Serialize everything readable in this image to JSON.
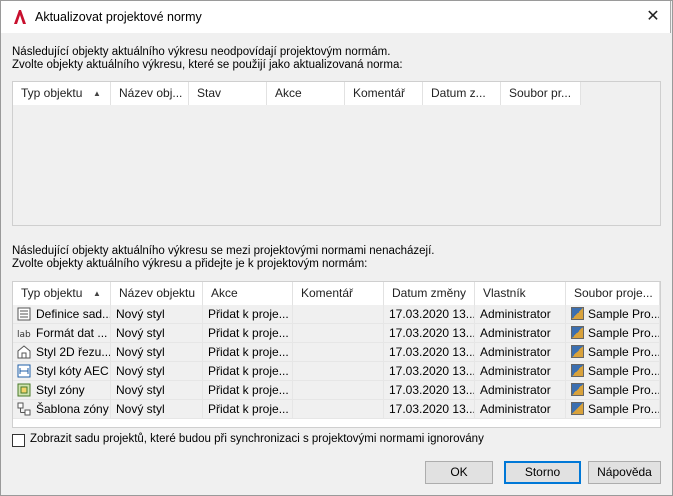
{
  "window": {
    "title": "Aktualizovat projektové normy"
  },
  "section1": {
    "line1": "Následující objekty aktuálního výkresu neodpovídají projektovým normám.",
    "line2": "Zvolte objekty aktuálního výkresu, které se použijí jako aktualizovaná norma:",
    "columns": [
      "Typ objektu",
      "Název obj...",
      "Stav",
      "Akce",
      "Komentář",
      "Datum z...",
      "Soubor pr..."
    ]
  },
  "section2": {
    "line1": "Následující objekty aktuálního výkresu se mezi projektovými normami nenacházejí.",
    "line2": "Zvolte objekty aktuálního výkresu a přidejte je k projektovým normám:",
    "columns": [
      "Typ objektu",
      "Název objektu",
      "Akce",
      "Komentář",
      "Datum změny",
      "Vlastník",
      "Soubor proje..."
    ],
    "rows": [
      {
        "icon": "property-set-definition-icon",
        "type": "Definice sad...",
        "name": "Nový styl",
        "action": "Přidat k proje...",
        "comment": "",
        "date": "17.03.2020 13...",
        "owner": "Administrator",
        "file": "Sample Pro..."
      },
      {
        "icon": "data-format-icon",
        "type": "Formát dat ...",
        "name": "Nový styl",
        "action": "Přidat k proje...",
        "comment": "",
        "date": "17.03.2020 13...",
        "owner": "Administrator",
        "file": "Sample Pro..."
      },
      {
        "icon": "2d-section-style-icon",
        "type": "Styl 2D řezu...",
        "name": "Nový styl",
        "action": "Přidat k proje...",
        "comment": "",
        "date": "17.03.2020 13...",
        "owner": "Administrator",
        "file": "Sample Pro..."
      },
      {
        "icon": "aec-dimension-style-icon",
        "type": "Styl kóty AEC",
        "name": "Nový styl",
        "action": "Přidat k proje...",
        "comment": "",
        "date": "17.03.2020 13...",
        "owner": "Administrator",
        "file": "Sample Pro..."
      },
      {
        "icon": "zone-style-icon",
        "type": "Styl zóny",
        "name": "Nový styl",
        "action": "Přidat k proje...",
        "comment": "",
        "date": "17.03.2020 13...",
        "owner": "Administrator",
        "file": "Sample Pro..."
      },
      {
        "icon": "zone-template-icon",
        "type": "Šablona zóny",
        "name": "Nový styl",
        "action": "Přidat k proje...",
        "comment": "",
        "date": "17.03.2020 13...",
        "owner": "Administrator",
        "file": "Sample Pro..."
      }
    ]
  },
  "ignored_checkbox": {
    "label": "Zobrazit sadu projektů, které budou při synchronizaci s projektovými normami ignorovány",
    "checked": false
  },
  "buttons": {
    "ok": "OK",
    "cancel": "Storno",
    "help": "Nápověda"
  },
  "colors": {
    "accent": "#0078d7",
    "app_icon": "#c8102e"
  }
}
